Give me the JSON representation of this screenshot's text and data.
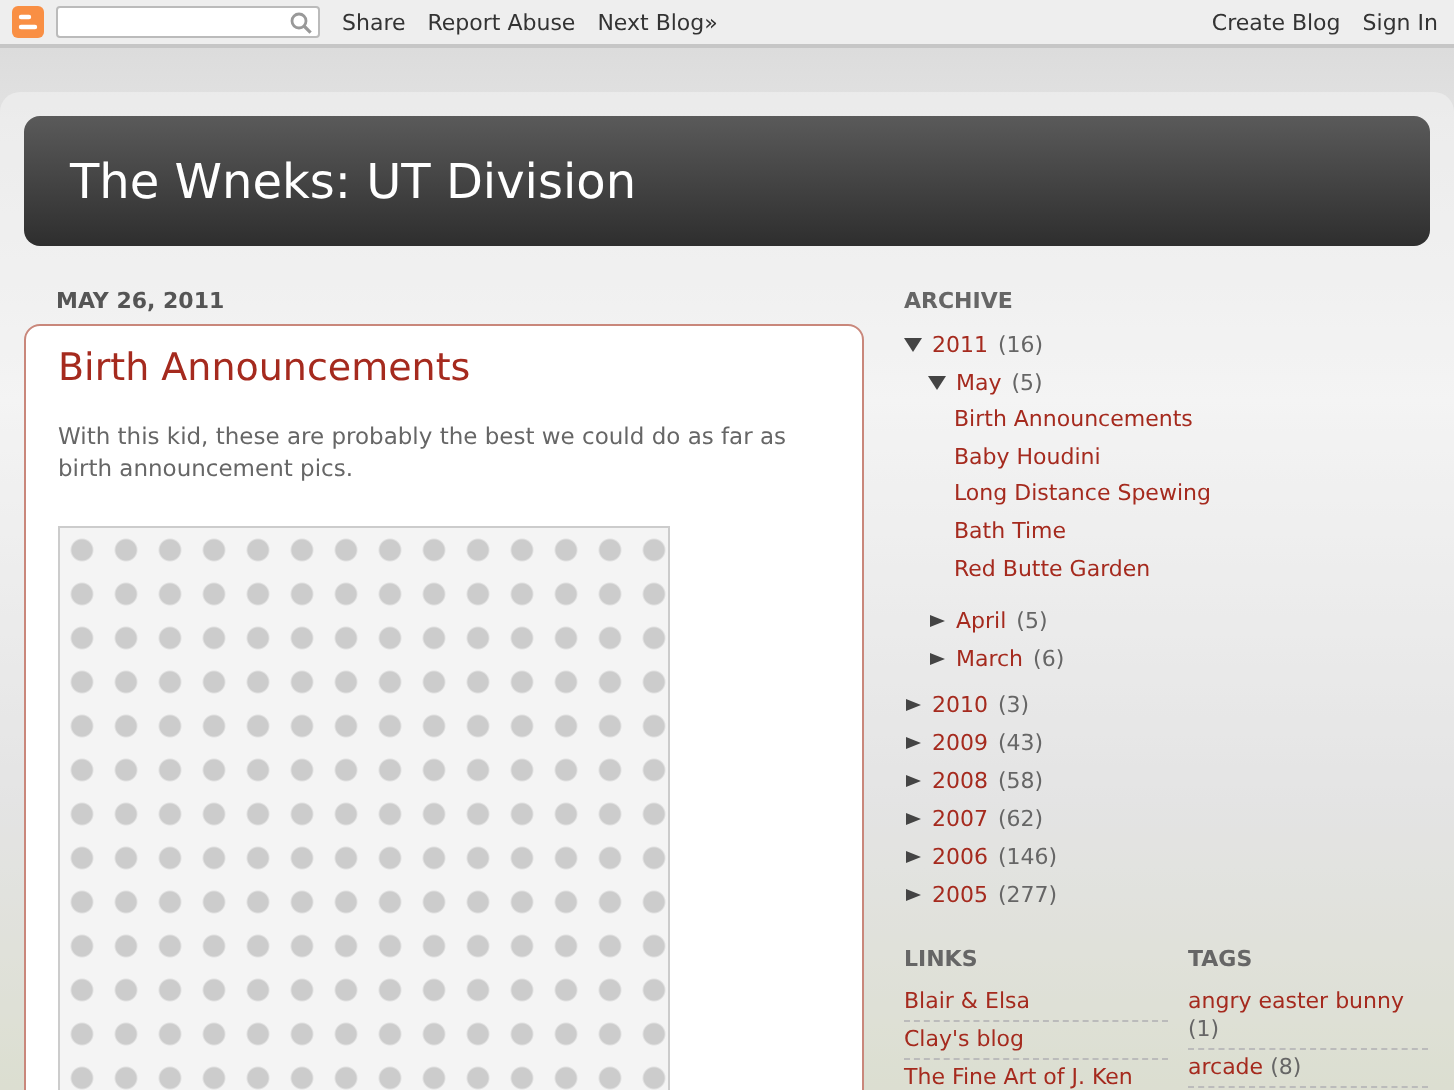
{
  "navbar": {
    "links": [
      "Share",
      "Report Abuse",
      "Next Blog»"
    ],
    "right_links": [
      "Create Blog",
      "Sign In"
    ]
  },
  "header": {
    "title": "The Wneks: UT Division"
  },
  "post": {
    "date": "MAY 26, 2011",
    "title": "Birth Announcements",
    "body": "With this kid, these are probably the best we could do as far as birth announcement pics."
  },
  "archive": {
    "title": "ARCHIVE",
    "years": [
      {
        "label": "2011",
        "count": "(16)",
        "expanded": true,
        "children": [
          {
            "label": "May",
            "count": "(5)",
            "expanded": true,
            "posts": [
              "Birth Announcements",
              "Baby Houdini",
              "Long Distance Spewing",
              "Bath Time",
              "Red Butte Garden"
            ]
          },
          {
            "label": "April",
            "count": "(5)",
            "expanded": false
          },
          {
            "label": "March",
            "count": "(6)",
            "expanded": false
          }
        ]
      },
      {
        "label": "2010",
        "count": "(3)",
        "expanded": false
      },
      {
        "label": "2009",
        "count": "(43)",
        "expanded": false
      },
      {
        "label": "2008",
        "count": "(58)",
        "expanded": false
      },
      {
        "label": "2007",
        "count": "(62)",
        "expanded": false
      },
      {
        "label": "2006",
        "count": "(146)",
        "expanded": false
      },
      {
        "label": "2005",
        "count": "(277)",
        "expanded": false
      }
    ]
  },
  "links": {
    "title": "LINKS",
    "items": [
      "Blair & Elsa",
      "Clay's blog",
      "The Fine Art of J. Ken"
    ]
  },
  "tags": {
    "title": "TAGS",
    "items": [
      {
        "label": "angry easter bunny",
        "count": "(1)"
      },
      {
        "label": "arcade",
        "count": "(8)"
      }
    ]
  }
}
